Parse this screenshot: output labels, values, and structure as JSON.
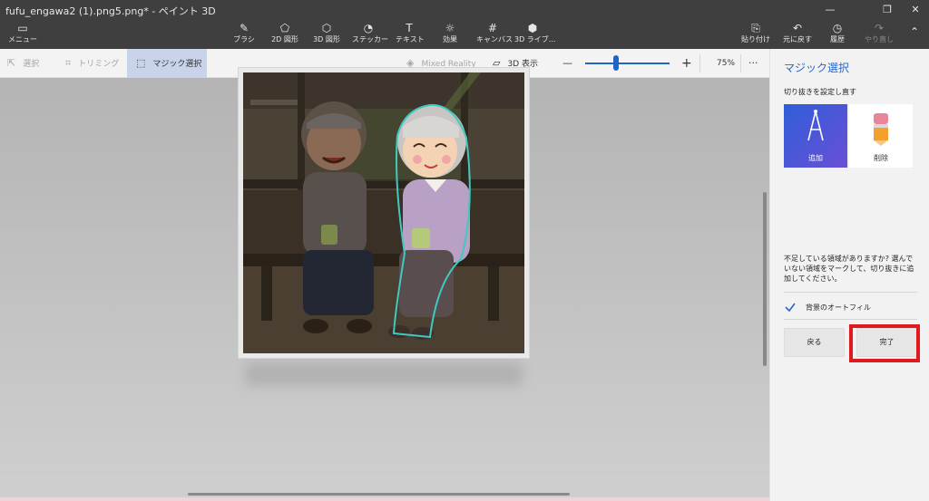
{
  "window": {
    "title": "fufu_engawa2 (1).png5.png* - ペイント 3D",
    "minimize_label": "—",
    "restore_label": "❐",
    "close_label": "✕"
  },
  "toolbar": {
    "menu_label": "メニュー",
    "tools": [
      {
        "label": "ブラシ",
        "icon": "brush-icon",
        "glyph": "✎"
      },
      {
        "label": "2D 図形",
        "icon": "2d-shapes-icon",
        "glyph": "⬠"
      },
      {
        "label": "3D 図形",
        "icon": "3d-shapes-icon",
        "glyph": "⬡"
      },
      {
        "label": "ステッカー",
        "icon": "sticker-icon",
        "glyph": "◔"
      },
      {
        "label": "テキスト",
        "icon": "text-icon",
        "glyph": "T"
      },
      {
        "label": "効果",
        "icon": "effects-icon",
        "glyph": "☼"
      },
      {
        "label": "キャンバス",
        "icon": "canvas-icon",
        "glyph": "#"
      },
      {
        "label": "3D ライブ...",
        "icon": "3d-library-icon",
        "glyph": "⬢"
      }
    ],
    "right_tools": [
      {
        "label": "貼り付け",
        "icon": "paste-icon",
        "glyph": "📋"
      },
      {
        "label": "元に戻す",
        "icon": "undo-icon",
        "glyph": "↶"
      },
      {
        "label": "履歴",
        "icon": "history-icon",
        "glyph": "◷"
      },
      {
        "label": "やり直し",
        "icon": "redo-icon",
        "glyph": "↷"
      }
    ]
  },
  "subbar": {
    "select_label": "選択",
    "crop_label": "トリミング",
    "magic_select_label": "マジック選択",
    "mixed_reality_label": "Mixed Reality",
    "view3d_label": "3D 表示",
    "zoom_minus": "—",
    "zoom_plus": "+",
    "zoom_level": "75%",
    "more_label": "···",
    "zoom_value_percent": 75
  },
  "panel": {
    "title": "マジック選択",
    "subtitle": "切り抜きを設定し直す",
    "add_label": "追加",
    "remove_label": "削除",
    "description": "不足している領域がありますか? 選んでいない領域をマークして、切り抜きに追加してください。",
    "autofill_label": "背景のオートフィル",
    "autofill_checked": true,
    "back_label": "戻る",
    "done_label": "完了"
  },
  "colors": {
    "accent": "#2a68c8",
    "highlight_box": "#e0191f"
  }
}
